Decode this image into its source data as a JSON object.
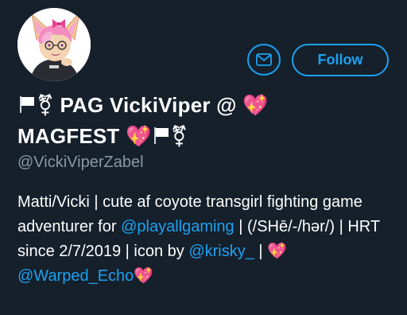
{
  "profile": {
    "name_line1_text": "PAG VickiViper @",
    "name_line2_text": "MAGFEST",
    "handle": "@VickiViperZabel",
    "follow_label": "Follow"
  },
  "icons": {
    "flag": "white-flag-icon",
    "trans_symbol": "transgender-symbol",
    "heart": "sparkling-heart",
    "message": "envelope-icon"
  },
  "emoji": {
    "trans_symbol": "⚧",
    "heart": "💖"
  },
  "bio": {
    "part1": "Matti/Vicki | cute af coyote transgirl fighting game adventurer for ",
    "link1": "@playallgaming",
    "part2": " | (/SHē/-/hər/) | HRT since 2/7/2019 | icon by ",
    "link2": "@krisky_",
    "part3": " | ",
    "link3": "@Warped_Echo"
  },
  "colors": {
    "background": "#15202b",
    "accent": "#1da1f2",
    "muted": "#8899a6",
    "heart": "#ff4fb4"
  }
}
